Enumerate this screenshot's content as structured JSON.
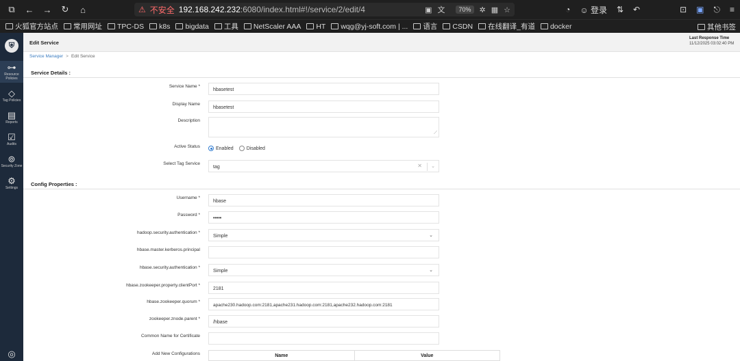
{
  "browser": {
    "url_warning": "不安全",
    "url_host": "192.168.242.232",
    "url_rest": ":6080/index.html#!/service/2/edit/4",
    "zoom": "70%",
    "profile_label": "登录"
  },
  "bookmarks": [
    "火狐官方站点",
    "常用网址",
    "TPC-DS",
    "k8s",
    "bigdata",
    "工具",
    "NetScaler AAA",
    "HT",
    "wqg@yj-soft.com | ...",
    "语言",
    "CSDN",
    "在线翻译_有道",
    "docker"
  ],
  "bookmarks_right": "其他书签",
  "sidebar": {
    "items": [
      {
        "label": "Resource Policies",
        "icon": "⊶"
      },
      {
        "label": "Tag Policies",
        "icon": "◇"
      },
      {
        "label": "Reports",
        "icon": "▤"
      },
      {
        "label": "Audits",
        "icon": "☑"
      },
      {
        "label": "Security Zone",
        "icon": "⊚"
      },
      {
        "label": "Settings",
        "icon": "⚙"
      }
    ]
  },
  "header": {
    "title": "Edit Service",
    "response_label": "Last Response Time",
    "response_time": "11/12/2025 03:02:40 PM"
  },
  "breadcrumb": {
    "parent": "Service Manager",
    "current": "Edit Service"
  },
  "sections": {
    "details": "Service Details :",
    "config": "Config Properties :"
  },
  "fields": {
    "service_name": {
      "label": "Service Name *",
      "value": "hbasetest"
    },
    "display_name": {
      "label": "Display Name",
      "value": "hbasetest"
    },
    "description": {
      "label": "Description",
      "value": ""
    },
    "active_status": {
      "label": "Active Status",
      "enabled": "Enabled",
      "disabled": "Disabled",
      "selected": "Enabled"
    },
    "tag_service": {
      "label": "Select Tag Service",
      "value": "tag"
    },
    "username": {
      "label": "Username *",
      "value": "hbase"
    },
    "password": {
      "label": "Password *",
      "value": "•••••"
    },
    "hadoop_auth": {
      "label": "hadoop.security.authentication *",
      "value": "Simple"
    },
    "hbase_principal": {
      "label": "hbase.master.kerberos.principal",
      "value": ""
    },
    "hbase_auth": {
      "label": "hbase.security.authentication *",
      "value": "Simple"
    },
    "zk_port": {
      "label": "hbase.zookeeper.property.clientPort *",
      "value": "2181"
    },
    "zk_quorum": {
      "label": "hbase.zookeeper.quorum *",
      "value": "apache230.hadoop.com:2181,apache231.hadoop.com:2181,apache232.hadoop.com:2181"
    },
    "zk_parent": {
      "label": "zookeeper.znode.parent *",
      "value": "/hbase"
    },
    "common_name": {
      "label": "Common Name for Certificate",
      "value": ""
    },
    "add_config": {
      "label": "Add New Configurations",
      "col_name": "Name",
      "col_value": "Value"
    }
  }
}
